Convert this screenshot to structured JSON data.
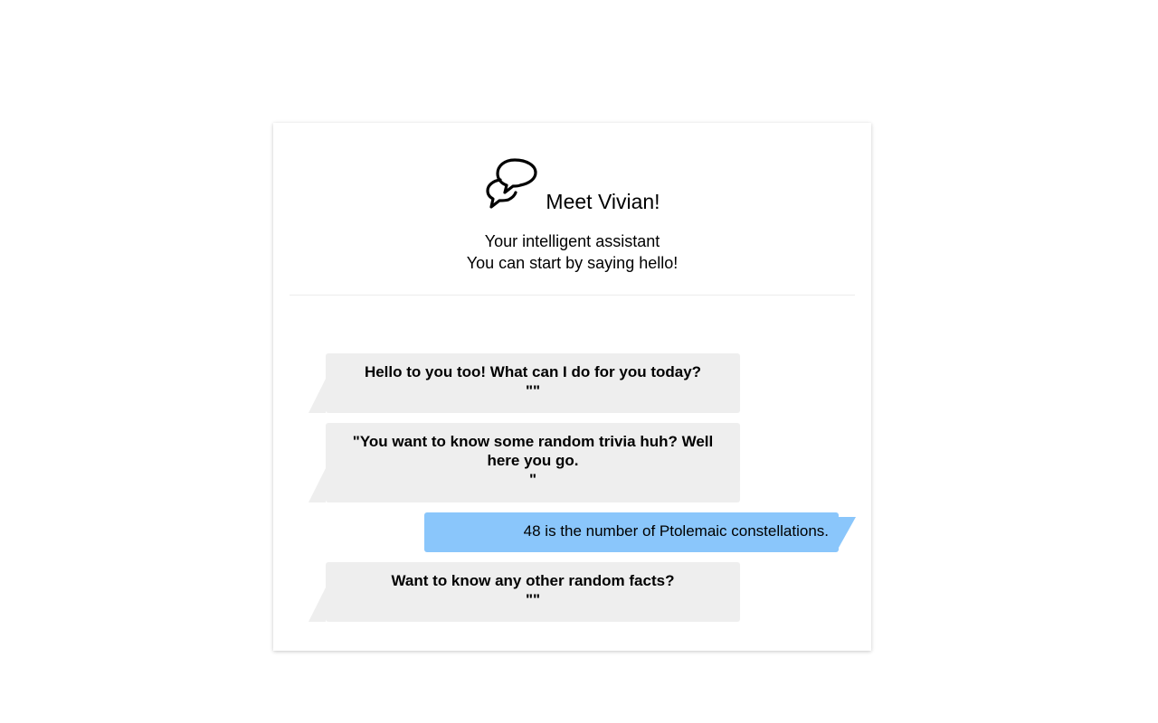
{
  "header": {
    "icon": "chat-bubbles-icon",
    "title": "Meet Vivian!",
    "subtitle_line1": "Your intelligent assistant",
    "subtitle_line2": "You can start by saying hello!"
  },
  "messages": [
    {
      "sender": "bot",
      "lines": [
        "Hello to you too! What can I do for you today?",
        "\"\""
      ]
    },
    {
      "sender": "bot",
      "lines": [
        "\"You want to know some random trivia huh? Well here you go.",
        "\""
      ]
    },
    {
      "sender": "user",
      "lines": [
        "48 is the number of Ptolemaic constellations."
      ]
    },
    {
      "sender": "bot",
      "lines": [
        "Want to know any other random facts?",
        "\"\""
      ]
    }
  ],
  "colors": {
    "bot_bubble": "#eeeeee",
    "user_bubble": "#8ac6fb",
    "divider": "#ececec"
  }
}
